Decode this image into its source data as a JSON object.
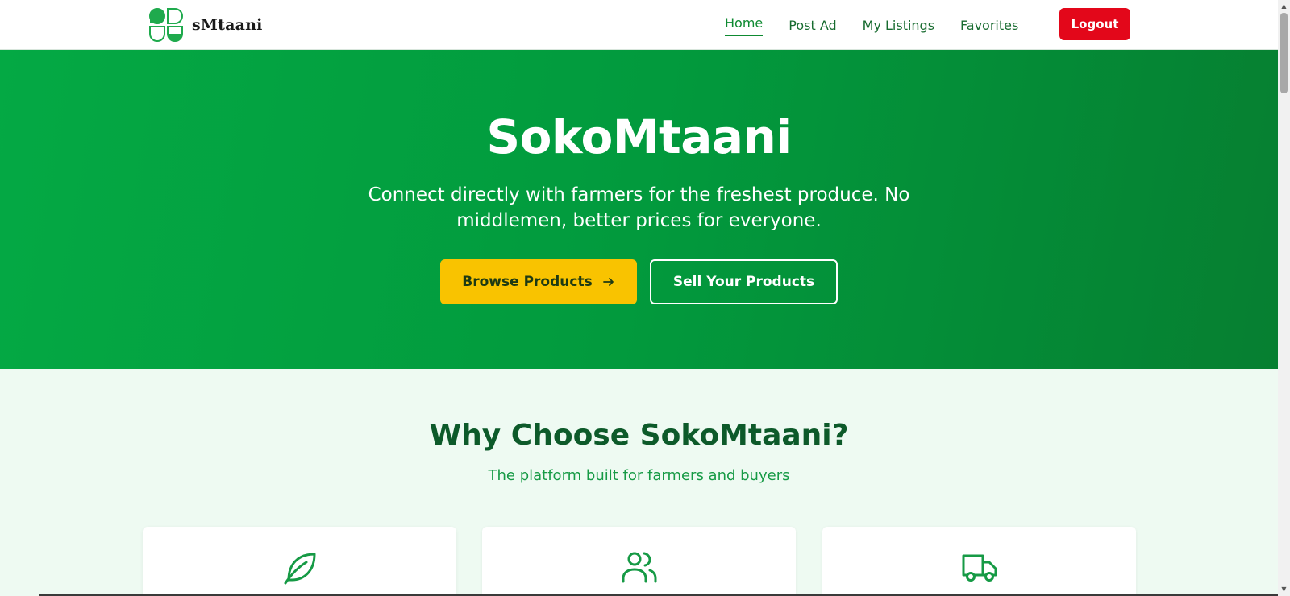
{
  "brand": {
    "name": "sMtaani"
  },
  "nav": {
    "items": [
      {
        "label": "Home",
        "active": true
      },
      {
        "label": "Post Ad",
        "active": false
      },
      {
        "label": "My Listings",
        "active": false
      },
      {
        "label": "Favorites",
        "active": false
      }
    ],
    "logout_label": "Logout"
  },
  "hero": {
    "title": "SokoMtaani",
    "subtitle": "Connect directly with farmers for the freshest produce. No middlemen, better prices for everyone.",
    "browse_label": "Browse Products",
    "sell_label": "Sell Your Products"
  },
  "features": {
    "title": "Why Choose SokoMtaani?",
    "subtitle": "The platform built for farmers and buyers",
    "cards": [
      {
        "icon": "leaf-icon"
      },
      {
        "icon": "users-icon"
      },
      {
        "icon": "truck-icon"
      }
    ]
  },
  "colors": {
    "primary_green": "#029a3d",
    "accent_yellow": "#f9c300",
    "logout_red": "#e3071a",
    "dark_green_text": "#0d5a2a"
  }
}
